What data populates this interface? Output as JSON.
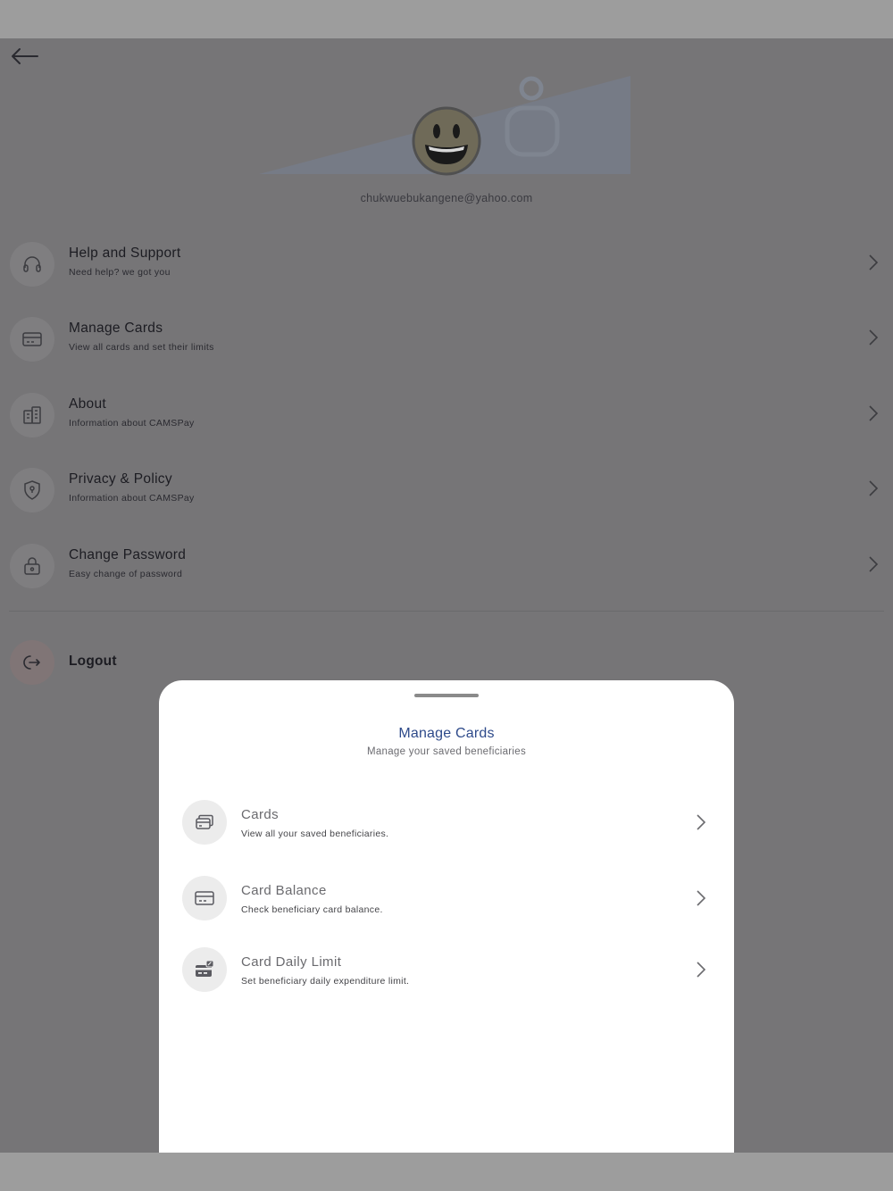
{
  "profile": {
    "email": "chukwuebukangene@yahoo.com"
  },
  "menu": {
    "items": [
      {
        "title": "Help and Support",
        "subtitle": "Need help? we got you",
        "icon": "headphones-icon"
      },
      {
        "title": "Manage Cards",
        "subtitle": "View all cards and set their limits",
        "icon": "credit-card-icon"
      },
      {
        "title": "About",
        "subtitle": "Information about CAMSPay",
        "icon": "building-icon"
      },
      {
        "title": "Privacy & Policy",
        "subtitle": "Information about CAMSPay",
        "icon": "shield-icon"
      },
      {
        "title": "Change Password",
        "subtitle": "Easy change of password",
        "icon": "lock-icon"
      }
    ],
    "logout_label": "Logout"
  },
  "sheet": {
    "title": "Manage Cards",
    "subtitle": "Manage your saved beneficiaries",
    "options": [
      {
        "title": "Cards",
        "subtitle": "View all your saved beneficiaries.",
        "icon": "cards-stack-icon"
      },
      {
        "title": "Card Balance",
        "subtitle": "Check beneficiary card balance.",
        "icon": "credit-card-icon"
      },
      {
        "title": "Card Daily Limit",
        "subtitle": "Set beneficiary daily expenditure limit.",
        "icon": "card-edit-icon"
      }
    ]
  },
  "colors": {
    "overlay_background": "#767577",
    "sheet_title": "#2e4a8a",
    "sheet_background": "#ffffff"
  }
}
